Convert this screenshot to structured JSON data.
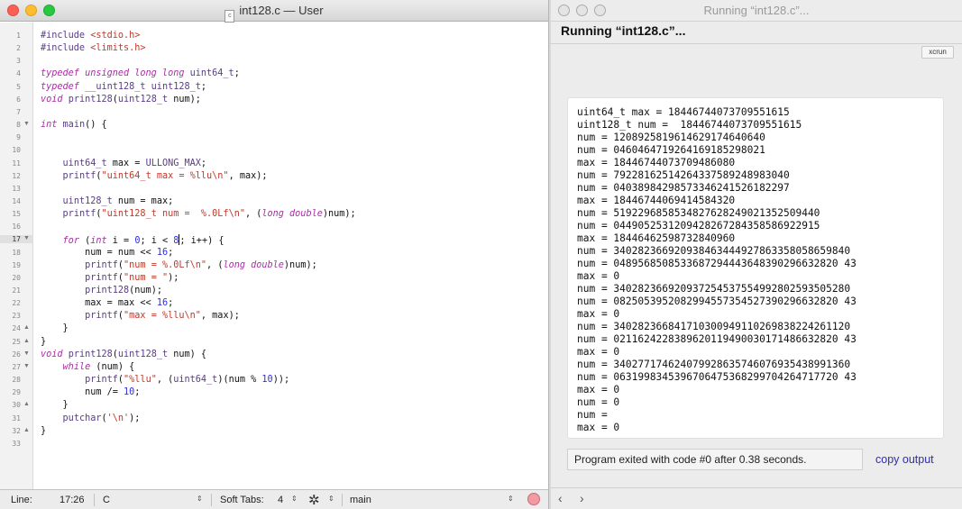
{
  "editor": {
    "title": "int128.c — User",
    "file_icon_letter": "c",
    "lines": [
      {
        "n": "1",
        "html": "<span class=\"pp\">#include</span> <span class=\"st\">&lt;stdio.h&gt;</span>"
      },
      {
        "n": "2",
        "html": "<span class=\"pp\">#include</span> <span class=\"st\">&lt;limits.h&gt;</span>"
      },
      {
        "n": "3",
        "html": ""
      },
      {
        "n": "4",
        "html": "<span class=\"kw\">typedef unsigned long long</span> <span class=\"pp\">uint64_t</span>;"
      },
      {
        "n": "5",
        "html": "<span class=\"kw\">typedef</span> <span class=\"pp\">__uint128_t uint128_t</span>;"
      },
      {
        "n": "6",
        "html": "<span class=\"kw\">void</span> <span class=\"pp\">print128</span>(<span class=\"pp\">uint128_t</span> num);"
      },
      {
        "n": "7",
        "html": ""
      },
      {
        "n": "8",
        "html": "<span class=\"kw\">int</span> <span class=\"pp\">main</span>() {",
        "fold": "▼"
      },
      {
        "n": "9",
        "html": ""
      },
      {
        "n": "10",
        "html": ""
      },
      {
        "n": "11",
        "html": "    <span class=\"pp\">uint64_t</span> max = <span class=\"pp\">ULLONG_MAX</span>;"
      },
      {
        "n": "12",
        "html": "    <span class=\"pp\">printf</span>(<span class=\"st\">\"uint64_t max = %llu\\n\"</span>, max);"
      },
      {
        "n": "13",
        "html": ""
      },
      {
        "n": "14",
        "html": "    <span class=\"pp\">uint128_t</span> num = max;"
      },
      {
        "n": "15",
        "html": "    <span class=\"pp\">printf</span>(<span class=\"st\">\"uint128_t num =  %.0Lf\\n\"</span>, (<span class=\"kw\">long double</span>)num);"
      },
      {
        "n": "16",
        "html": ""
      },
      {
        "n": "17",
        "html": "    <span class=\"kw\">for</span> (<span class=\"kw\">int</span> i = <span class=\"nm\">0</span>; i &lt; <span class=\"nm\">8</span><span class=\"cursor\"></span>; i++) {",
        "fold": "▼",
        "current": true
      },
      {
        "n": "18",
        "html": "        num = num &lt;&lt; <span class=\"nm\">16</span>;"
      },
      {
        "n": "19",
        "html": "        <span class=\"pp\">printf</span>(<span class=\"st\">\"num = %.0Lf\\n\"</span>, (<span class=\"kw\">long double</span>)num);"
      },
      {
        "n": "20",
        "html": "        <span class=\"pp\">printf</span>(<span class=\"st\">\"num = \"</span>);"
      },
      {
        "n": "21",
        "html": "        <span class=\"pp\">print128</span>(num);"
      },
      {
        "n": "22",
        "html": "        max = max &lt;&lt; <span class=\"nm\">16</span>;"
      },
      {
        "n": "23",
        "html": "        <span class=\"pp\">printf</span>(<span class=\"st\">\"max = %llu\\n\"</span>, max);"
      },
      {
        "n": "24",
        "html": "    }",
        "fold": "▲"
      },
      {
        "n": "25",
        "html": "}",
        "fold": "▲"
      },
      {
        "n": "26",
        "html": "<span class=\"kw\">void</span> <span class=\"pp\">print128</span>(<span class=\"pp\">uint128_t</span> num) {",
        "fold": "▼"
      },
      {
        "n": "27",
        "html": "    <span class=\"kw\">while</span> (num) {",
        "fold": "▼"
      },
      {
        "n": "28",
        "html": "        <span class=\"pp\">printf</span>(<span class=\"st\">\"%llu\"</span>, (<span class=\"pp\">uint64_t</span>)(num % <span class=\"nm\">10</span>));"
      },
      {
        "n": "29",
        "html": "        num /= <span class=\"nm\">10</span>;"
      },
      {
        "n": "30",
        "html": "    }",
        "fold": "▲"
      },
      {
        "n": "31",
        "html": "    <span class=\"pp\">putchar</span>(<span class=\"st\">'\\n'</span>);"
      },
      {
        "n": "32",
        "html": "}",
        "fold": "▲"
      },
      {
        "n": "33",
        "html": ""
      }
    ],
    "status": {
      "line_label": "Line:",
      "position": "17:26",
      "language": "C",
      "tabs_label": "Soft Tabs:",
      "tabs_value": "4",
      "symbol": "main"
    }
  },
  "run": {
    "window_title": "Running “int128.c”...",
    "heading": "Running “int128.c”...",
    "xcrun_label": "xcrun",
    "output_lines": [
      "uint64_t max = 18446744073709551615",
      "uint128_t num =  18446744073709551615",
      "num = 1208925819614629174640640",
      "num = 0460464719264169185298021",
      "max = 18446744073709486080",
      "num = 79228162514264337589248983040",
      "num = 04038984298573346241526182297",
      "max = 18446744069414584320",
      "num = 5192296858534827628249021352509440",
      "num = 0449052531209428267284358586922915",
      "max = 18446462598732840960",
      "num = 340282366920938463444927863358058659840",
      "num = 0489568508533687294443648390296632820 43",
      "max = 0",
      "num = 340282366920937254537554992802593505280",
      "num = 0825053952082994557354527390296632820 43",
      "max = 0",
      "num = 340282366841710300949110269838224261120",
      "num = 0211624228389620119490030171486632820 43",
      "max = 0",
      "num = 340277174624079928635746076935438991360",
      "num = 0631998345396706475368299704264717720 43",
      "max = 0",
      "num = 0",
      "num = ",
      "max = 0"
    ],
    "exit_message": "Program exited with code #0 after 0.38 seconds.",
    "copy_label": "copy output",
    "back_arrow": "‹",
    "forward_arrow": "›"
  }
}
